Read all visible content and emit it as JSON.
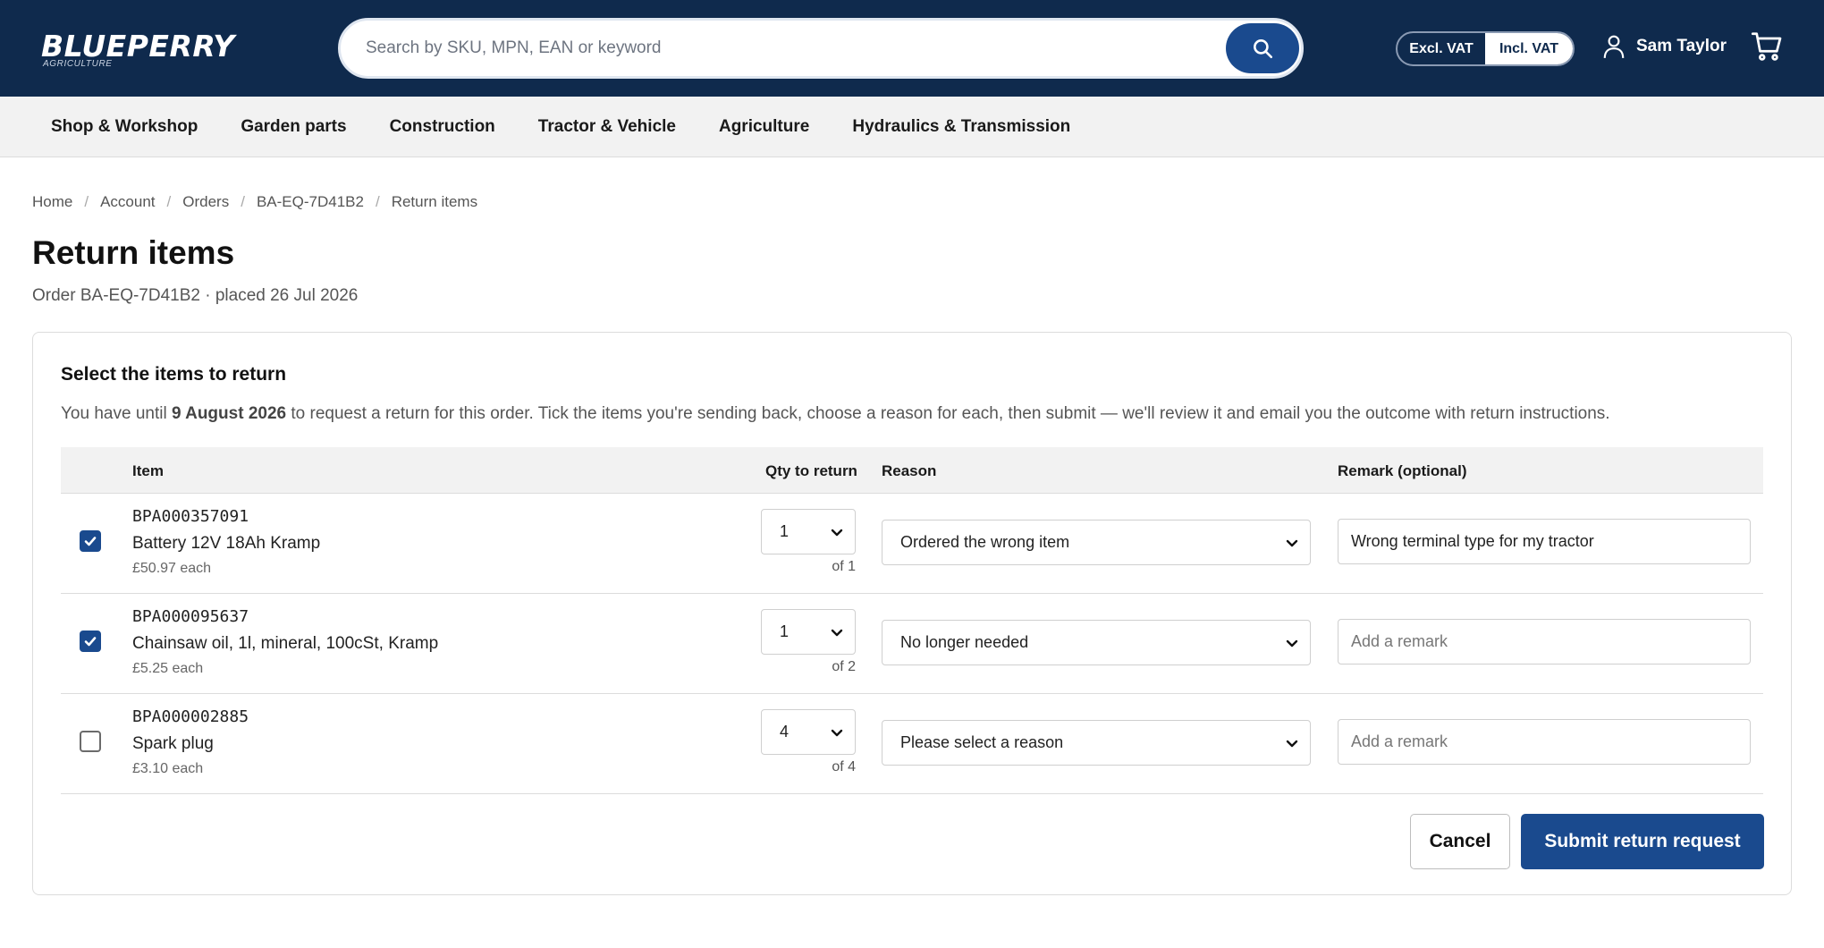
{
  "header": {
    "logo_main": "BLUEPERRY",
    "logo_sub": "AGRICULTURE",
    "search_placeholder": "Search by SKU, MPN, EAN or keyword",
    "vat_excl": "Excl. VAT",
    "vat_incl": "Incl. VAT",
    "vat_selected": "Incl. VAT",
    "user_name": "Sam Taylor",
    "icons": [
      "search-icon",
      "user-icon",
      "cart-icon"
    ]
  },
  "nav": {
    "items": [
      {
        "label": "Shop & Workshop"
      },
      {
        "label": "Garden parts"
      },
      {
        "label": "Construction"
      },
      {
        "label": "Tractor & Vehicle"
      },
      {
        "label": "Agriculture"
      },
      {
        "label": "Hydraulics & Transmission"
      }
    ]
  },
  "breadcrumb": {
    "items": [
      "Home",
      "Account",
      "Orders",
      "BA-EQ-7D41B2",
      "Return items"
    ]
  },
  "page": {
    "title": "Return items",
    "order_meta": "Order BA-EQ-7D41B2 · placed 26 Jul 2026"
  },
  "card": {
    "title": "Select the items to return",
    "desc_prefix": "You have until ",
    "desc_date": "9 August 2026",
    "desc_suffix": " to request a return for this order. Tick the items you're sending back, choose a reason for each, then submit — we'll review it and email you the outcome with return instructions."
  },
  "table": {
    "headers": {
      "item": "Item",
      "qty": "Qty to return",
      "reason": "Reason",
      "remark": "Remark (optional)"
    },
    "rows": [
      {
        "checked": true,
        "sku": "BPA000357091",
        "name": "Battery 12V 18Ah Kramp",
        "price": "£50.97 each",
        "qty": "1",
        "qty_of": "of 1",
        "reason": "Ordered the wrong item",
        "remark_value": "Wrong terminal type for my tractor",
        "remark_placeholder": "Add a remark"
      },
      {
        "checked": true,
        "sku": "BPA000095637",
        "name": "Chainsaw oil, 1l, mineral, 100cSt, Kramp",
        "price": "£5.25 each",
        "qty": "1",
        "qty_of": "of 2",
        "reason": "No longer needed",
        "remark_value": "",
        "remark_placeholder": "Add a remark"
      },
      {
        "checked": false,
        "sku": "BPA000002885",
        "name": "Spark plug",
        "price": "£3.10 each",
        "qty": "4",
        "qty_of": "of 4",
        "reason": "Please select a reason",
        "remark_value": "",
        "remark_placeholder": "Add a remark"
      }
    ]
  },
  "actions": {
    "cancel_label": "Cancel",
    "submit_label": "Submit return request"
  },
  "colors": {
    "header_bg": "#0f2a4d",
    "primary": "#1a4a8e",
    "nav_bg": "#f2f2f2"
  }
}
